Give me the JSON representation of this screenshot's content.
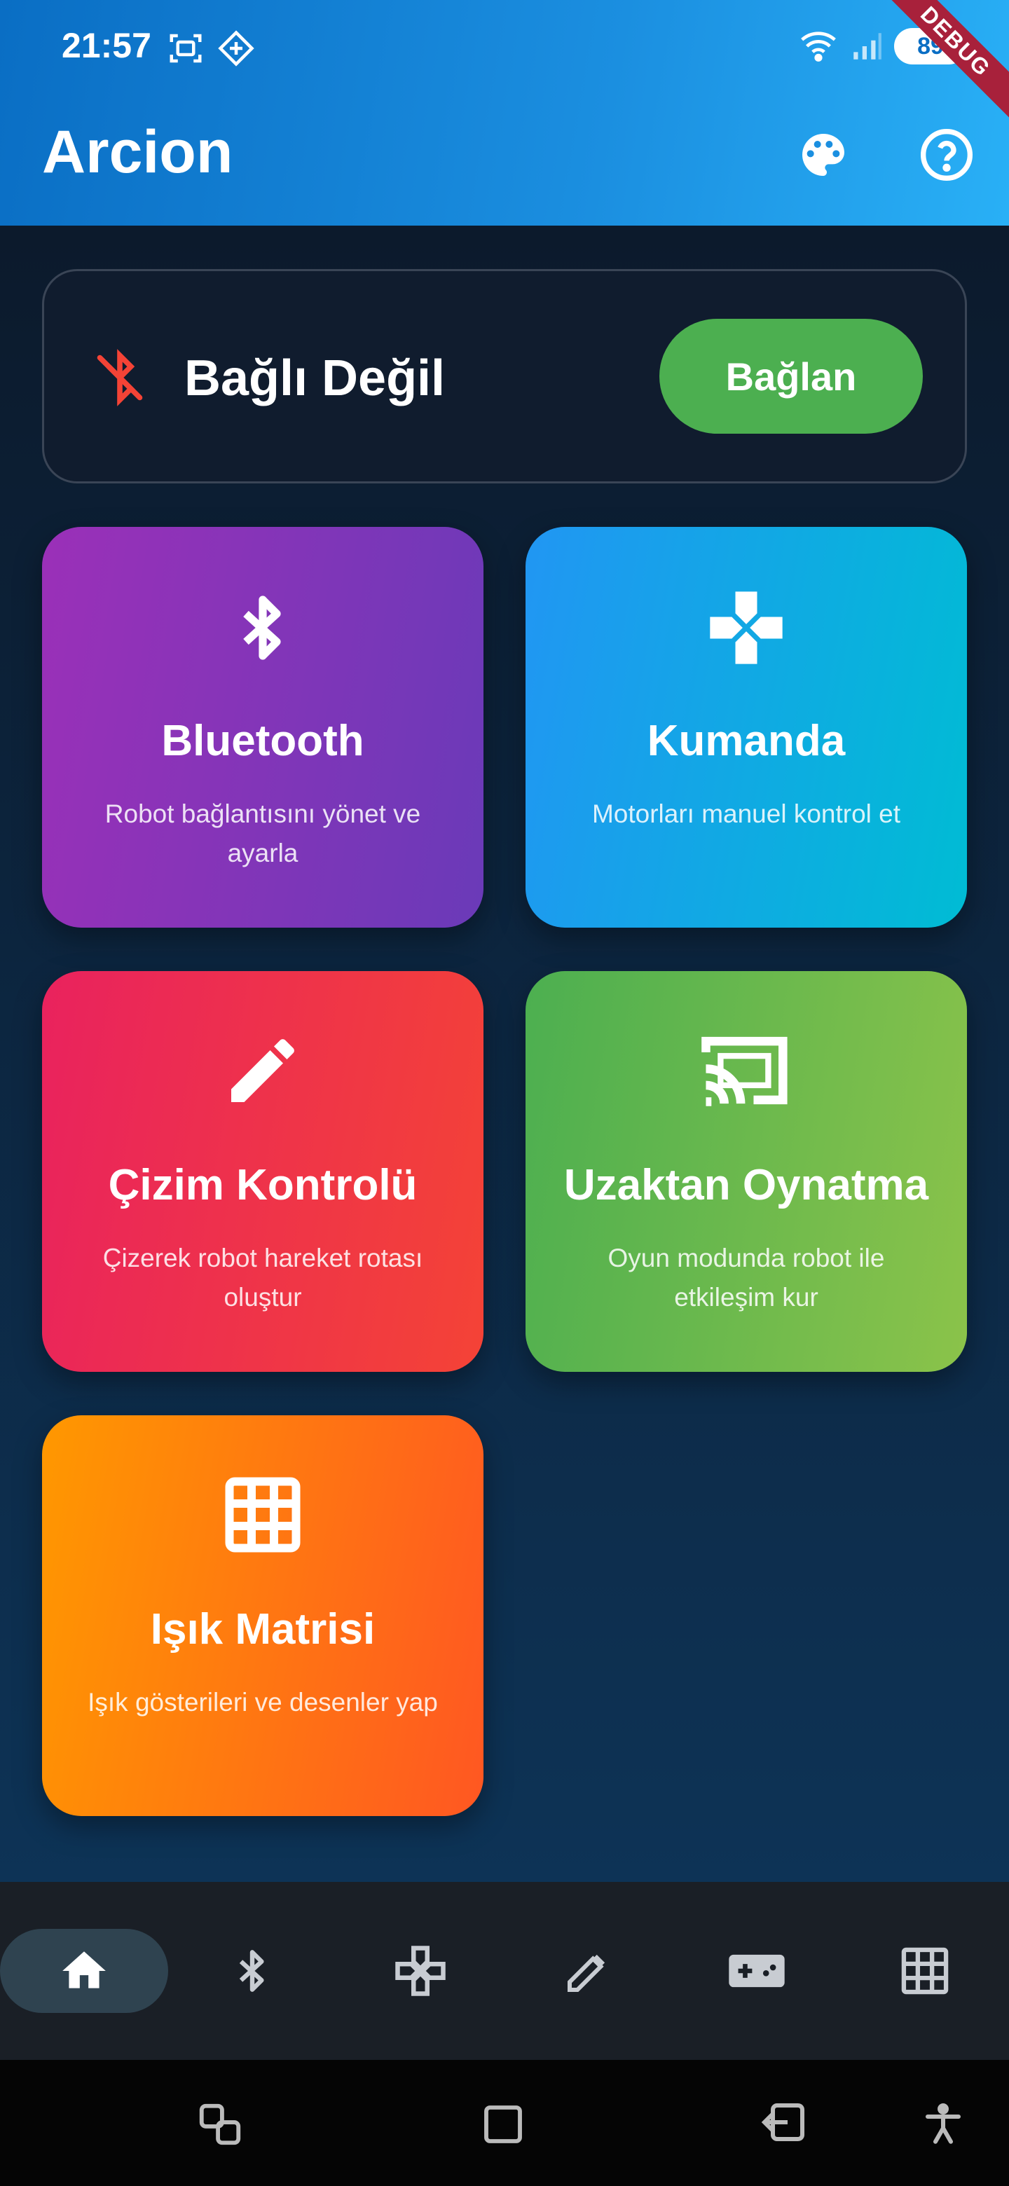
{
  "status_bar": {
    "time": "21:57",
    "battery": "89"
  },
  "debug_banner": "DEBUG",
  "app_bar": {
    "title": "Arcion",
    "actions": [
      {
        "icon": "palette-icon"
      },
      {
        "icon": "help-icon"
      }
    ]
  },
  "connection": {
    "status": "Bağlı Değil",
    "status_icon": "bluetooth-disabled-icon",
    "status_color": "#f44336",
    "connect_label": "Bağlan",
    "connect_color": "#4caf50"
  },
  "tiles": [
    {
      "title": "Bluetooth",
      "subtitle": "Robot bağlantısını yönet ve ayarla",
      "icon": "bluetooth-icon",
      "colors": [
        "#9b30b8",
        "#6a3ab8"
      ]
    },
    {
      "title": "Kumanda",
      "subtitle": "Motorları manuel kontrol et",
      "icon": "dpad-icon",
      "colors": [
        "#2196f3",
        "#00bcd4"
      ]
    },
    {
      "title": "Çizim Kontrolü",
      "subtitle": "Çizerek robot hareket rotası oluştur",
      "icon": "pencil-icon",
      "colors": [
        "#e9225e",
        "#f44336"
      ]
    },
    {
      "title": "Uzaktan Oynatma",
      "subtitle": "Oyun modunda robot ile etkileşim kur",
      "icon": "cast-icon",
      "colors": [
        "#4caf50",
        "#8bc34a"
      ]
    },
    {
      "title": "Işık Matrisi",
      "subtitle": "Işık gösterileri ve desenler yap",
      "icon": "grid-icon",
      "colors": [
        "#ff9800",
        "#ff5722"
      ]
    }
  ],
  "bottom_nav": {
    "active": 0,
    "items": [
      "home-icon",
      "bluetooth-icon",
      "dpad-outline-icon",
      "pencil-icon",
      "gamepad-icon",
      "grid-icon"
    ]
  }
}
